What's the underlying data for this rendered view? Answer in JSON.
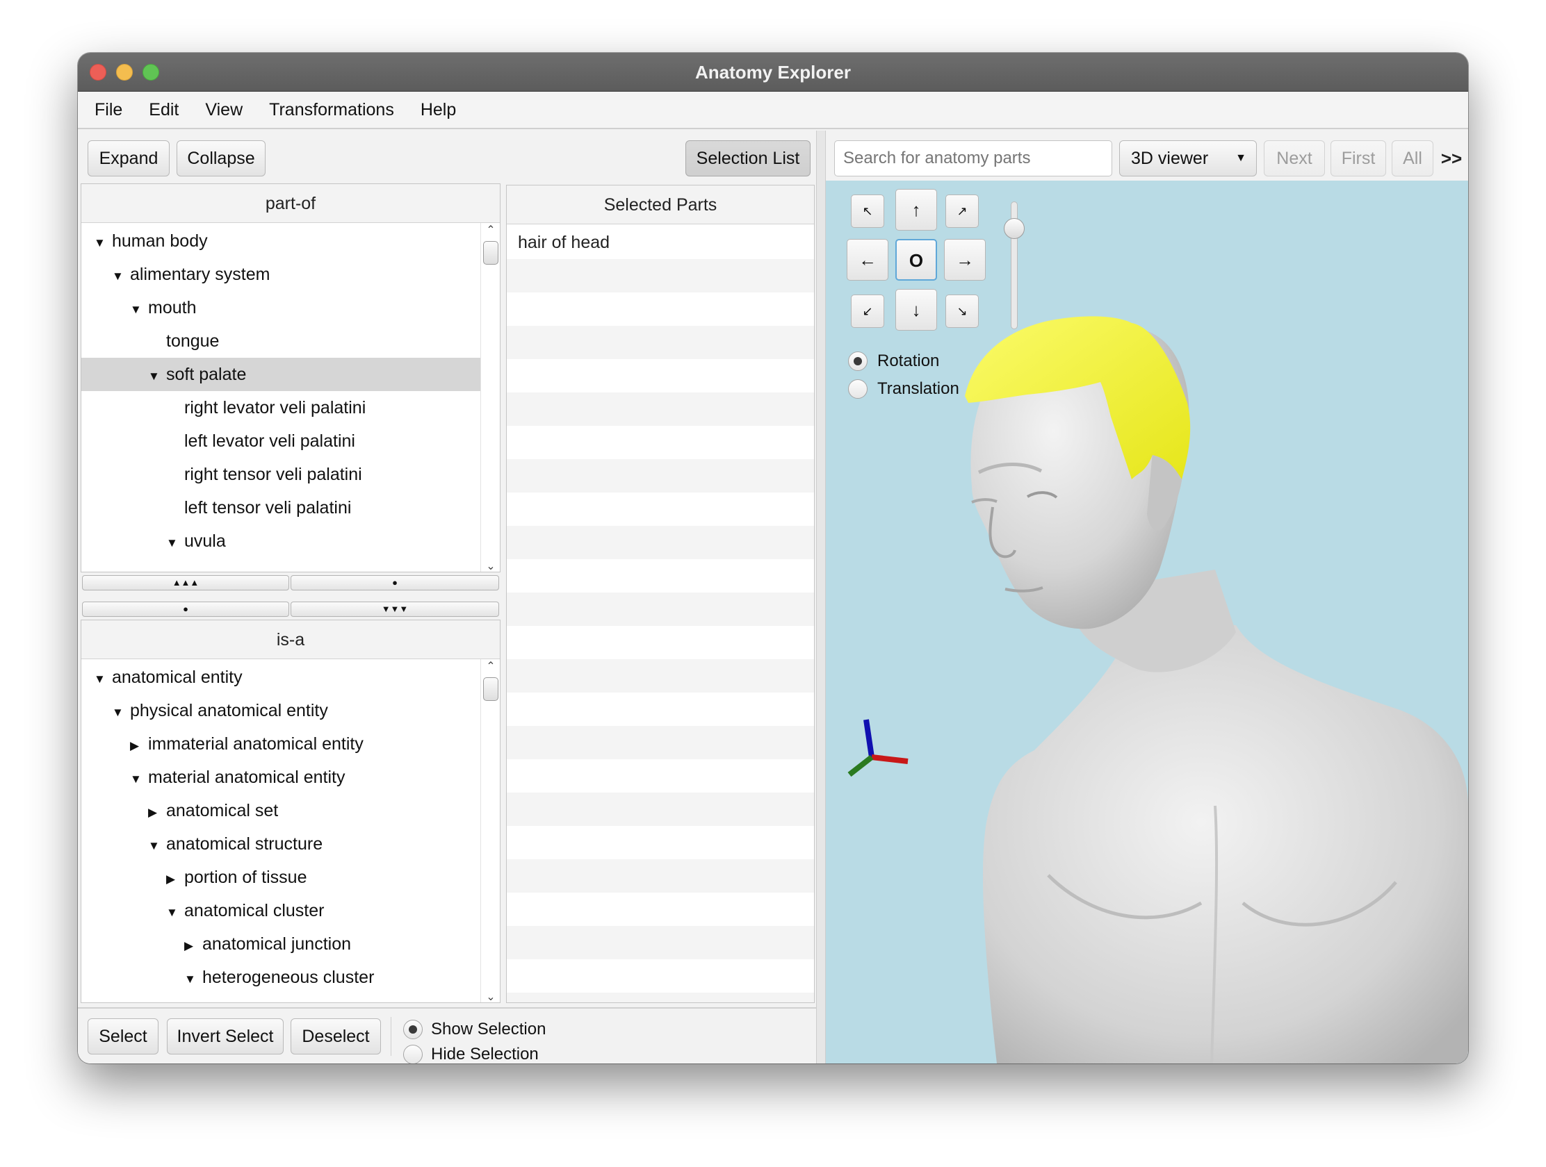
{
  "window": {
    "title": "Anatomy Explorer"
  },
  "menu": [
    "File",
    "Edit",
    "View",
    "Transformations",
    "Help"
  ],
  "toolbar": {
    "expand": "Expand",
    "collapse": "Collapse",
    "selection_list": "Selection List"
  },
  "part_of": {
    "header": "part-of",
    "rows": [
      {
        "label": "human body",
        "arrow": "▼"
      },
      {
        "label": "alimentary system",
        "arrow": "▼"
      },
      {
        "label": "mouth",
        "arrow": "▼"
      },
      {
        "label": "tongue",
        "arrow": ""
      },
      {
        "label": "soft palate",
        "arrow": "▼"
      },
      {
        "label": "right levator veli palatini",
        "arrow": ""
      },
      {
        "label": "left levator veli palatini",
        "arrow": ""
      },
      {
        "label": "right tensor veli palatini",
        "arrow": ""
      },
      {
        "label": "left tensor veli palatini",
        "arrow": ""
      },
      {
        "label": "uvula",
        "arrow": "▼"
      }
    ]
  },
  "splitter_buttons": {
    "up": "▲▲▲",
    "dot": "●",
    "down": "▼▼▼"
  },
  "is_a": {
    "header": "is-a",
    "rows": [
      {
        "label": "anatomical entity",
        "arrow": "▼"
      },
      {
        "label": "physical anatomical entity",
        "arrow": "▼"
      },
      {
        "label": "immaterial anatomical entity",
        "arrow": "▶"
      },
      {
        "label": "material anatomical entity",
        "arrow": "▼"
      },
      {
        "label": "anatomical set",
        "arrow": "▶"
      },
      {
        "label": "anatomical structure",
        "arrow": "▼"
      },
      {
        "label": "portion of tissue",
        "arrow": "▶"
      },
      {
        "label": "anatomical cluster",
        "arrow": "▼"
      },
      {
        "label": "anatomical junction",
        "arrow": "▶"
      },
      {
        "label": "heterogeneous cluster",
        "arrow": "▼"
      }
    ]
  },
  "selected_parts": {
    "header": "Selected Parts",
    "items": [
      "hair of head"
    ]
  },
  "bottom": {
    "select": "Select",
    "invert_select": "Invert Select",
    "deselect": "Deselect",
    "show_selection": "Show Selection",
    "hide_selection": "Hide Selection",
    "show_selected": true
  },
  "viewer_toolbar": {
    "search_placeholder": "Search for anatomy parts",
    "viewer_mode": "3D viewer",
    "next": "Next",
    "first": "First",
    "all": "All",
    "overflow": ">>"
  },
  "nav": {
    "up_left": "↖",
    "up": "↑",
    "up_right": "↗",
    "left": "←",
    "center": "O",
    "right": "→",
    "down_left": "↙",
    "down": "↓",
    "down_right": "↘",
    "zoom_level": 0.85
  },
  "mode": {
    "rotation": "Rotation",
    "translation": "Translation",
    "rotation_selected": true
  },
  "colors": {
    "viewer_bg": "#b9dbe5",
    "highlight": "#f5f53a",
    "body": "#d9d9d9"
  }
}
